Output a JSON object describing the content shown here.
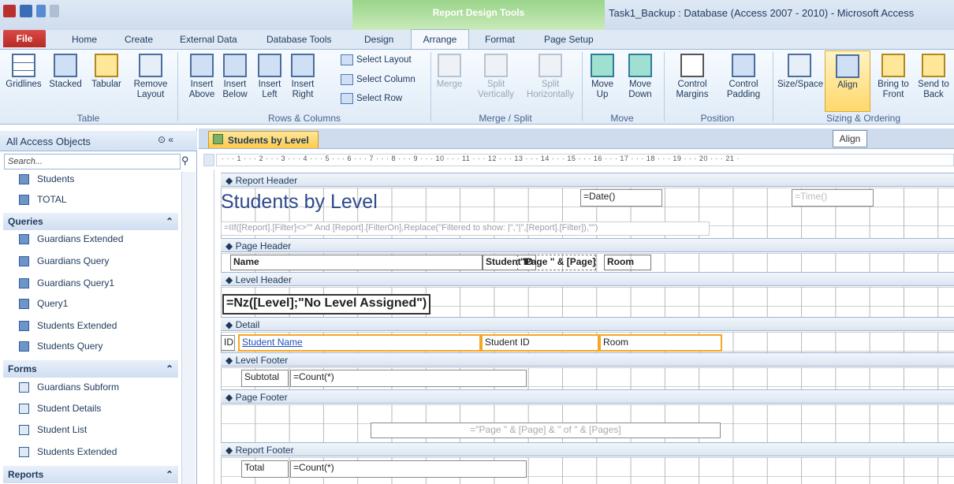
{
  "title_bar": {
    "contextual_tab": "Report Design Tools",
    "window_title": "Task1_Backup : Database (Access 2007 - 2010)  -  Microsoft Access"
  },
  "tabs": [
    "File",
    "Home",
    "Create",
    "External Data",
    "Database Tools",
    "Design",
    "Arrange",
    "Format",
    "Page Setup"
  ],
  "ribbon": {
    "table": {
      "label": "Table",
      "buttons": [
        "Gridlines",
        "Stacked",
        "Tabular",
        "Remove Layout"
      ]
    },
    "rows_columns": {
      "label": "Rows & Columns",
      "buttons": [
        "Insert Above",
        "Insert Below",
        "Insert Left",
        "Insert Right"
      ],
      "small": [
        "Select Layout",
        "Select Column",
        "Select Row"
      ]
    },
    "merge_split": {
      "label": "Merge / Split",
      "buttons": [
        "Merge",
        "Split Vertically",
        "Split Horizontally"
      ]
    },
    "move": {
      "label": "Move",
      "buttons": [
        "Move Up",
        "Move Down"
      ]
    },
    "position": {
      "label": "Position",
      "buttons": [
        "Control Margins",
        "Control Padding"
      ]
    },
    "sizing": {
      "label": "Sizing & Ordering",
      "buttons": [
        "Size/Space",
        "Align",
        "Bring to Front",
        "Send to Back"
      ]
    }
  },
  "nav": {
    "title": "All Access Objects",
    "search_placeholder": "Search...",
    "tables": [
      "Students",
      "TOTAL"
    ],
    "queries_label": "Queries",
    "queries": [
      "Guardians Extended",
      "Guardians Query",
      "Guardians Query1",
      "Query1",
      "Students Extended",
      "Students Query"
    ],
    "forms_label": "Forms",
    "forms": [
      "Guardians Subform",
      "Student Details",
      "Student List",
      "Students Extended"
    ],
    "reports_label": "Reports"
  },
  "document": {
    "tab": "Students by Level",
    "tooltip": "Align"
  },
  "ruler": "· · · 1 · · · 2 · · · 3 · · · 4 · · · 5 · · · 6 · · · 7 · · · 8 · · · 9 · · · 10 · · · 11 · · · 12 · · · 13 · · · 14 · · · 15 · · · 16 · · · 17 · · · 18 · · · 19 · · · 20 · · · 21 ·",
  "report": {
    "bands": [
      "Report Header",
      "Page Header",
      "Level Header",
      "Detail",
      "Level Footer",
      "Page Footer",
      "Report Footer"
    ],
    "title": "Students by Level",
    "date": "=Date()",
    "time": "=Time()",
    "filter_expr": "=IIf([Report].[Filter]<>\"\" And [Report].[FilterOn],Replace(\"Filtered to show: |\",\"|\",[Report].[Filter]),\"\")",
    "ph_name": "Name",
    "ph_student": "Student ID",
    "ph_page": "\"Page \" & [Page]",
    "ph_room": "Room",
    "level_expr": "=Nz([Level];\"No Level Assigned\")",
    "id": "ID",
    "student_name": "Student Name",
    "student_id": "Student ID",
    "room": "Room",
    "subtotal": "Subtotal",
    "count1": "=Count(*)",
    "page_footer": "=\"Page \" & [Page] & \" of \" & [Pages]",
    "total": "Total",
    "count2": "=Count(*)"
  }
}
